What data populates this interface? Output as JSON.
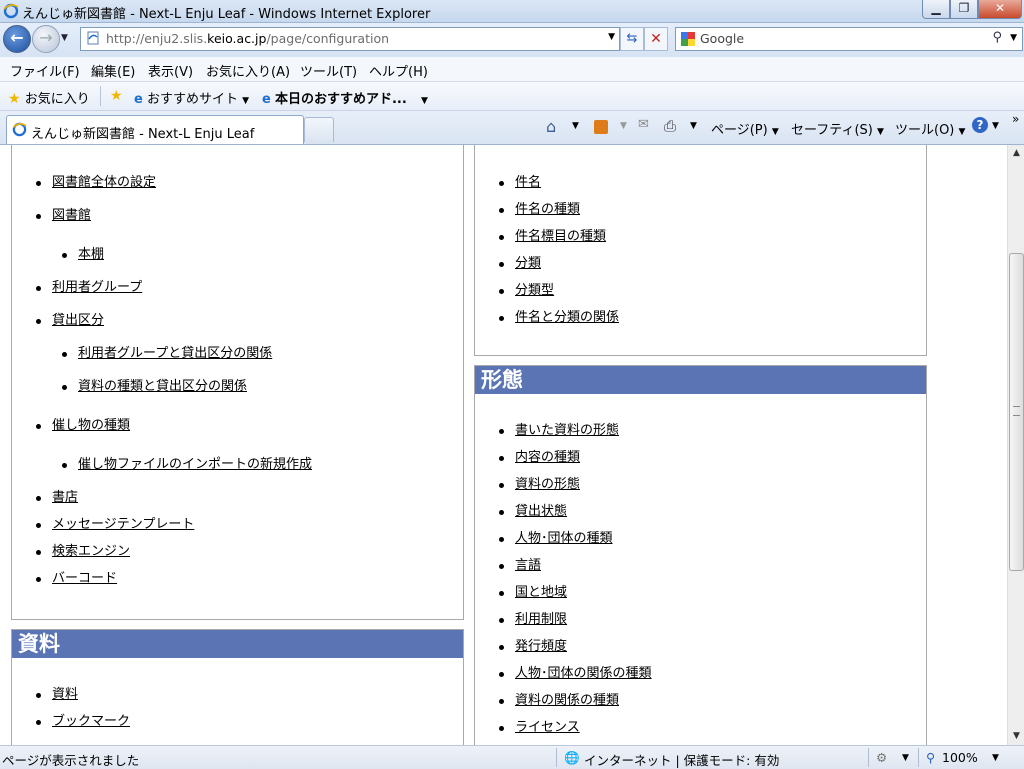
{
  "window": {
    "title": "えんじゅ新図書館 - Next-L Enju Leaf - Windows Internet Explorer"
  },
  "address": {
    "url_prefix": "http://enju2.slis.",
    "url_host": "keio.ac.jp",
    "url_path": "/page/configuration"
  },
  "search": {
    "provider": "Google"
  },
  "menu": [
    "ファイル(F)",
    "編集(E)",
    "表示(V)",
    "お気に入り(A)",
    "ツール(T)",
    "ヘルプ(H)"
  ],
  "favorites": {
    "favorites_label": "お気に入り",
    "suggested_sites": "おすすめサイト",
    "web_slice": "本日のおすすめアド..."
  },
  "tab": {
    "title": "えんじゅ新図書館 - Next-L Enju Leaf"
  },
  "commands": {
    "page": "ページ(P)",
    "safety": "セーフティ(S)",
    "tools": "ツール(O)"
  },
  "left": {
    "items": [
      {
        "label": "図書館全体の設定"
      },
      {
        "label": "図書館"
      },
      {
        "label": "本棚"
      },
      {
        "label": "利用者グループ"
      },
      {
        "label": "貸出区分"
      },
      {
        "label": "利用者グループと貸出区分の関係"
      },
      {
        "label": "資料の種類と貸出区分の関係"
      },
      {
        "label": "催し物の種類"
      },
      {
        "label": "催し物ファイルのインポートの新規作成"
      },
      {
        "label": "書店"
      },
      {
        "label": "メッセージテンプレート"
      },
      {
        "label": "検索エンジン"
      },
      {
        "label": "バーコード"
      }
    ],
    "materials_heading": "資料",
    "materials_items": [
      {
        "label": "資料"
      },
      {
        "label": "ブックマーク"
      }
    ]
  },
  "right": {
    "items": [
      {
        "label": "件名"
      },
      {
        "label": "件名の種類"
      },
      {
        "label": "件名標目の種類"
      },
      {
        "label": "分類"
      },
      {
        "label": "分類型"
      },
      {
        "label": "件名と分類の関係"
      }
    ],
    "form_heading": "形態",
    "form_items": [
      {
        "label": "書いた資料の形態"
      },
      {
        "label": "内容の種類"
      },
      {
        "label": "資料の形態"
      },
      {
        "label": "貸出状態"
      },
      {
        "label": "人物･団体の種類"
      },
      {
        "label": "言語"
      },
      {
        "label": "国と地域"
      },
      {
        "label": "利用制限"
      },
      {
        "label": "発行頻度"
      },
      {
        "label": "人物･団体の関係の種類"
      },
      {
        "label": "資料の関係の種類"
      },
      {
        "label": "ライセンス"
      }
    ]
  },
  "status": {
    "text": "ページが表示されました",
    "zone": "インターネット | 保護モード: 有効",
    "zoom": "100%"
  },
  "colors": {
    "section_heading": "#5a74b4"
  }
}
